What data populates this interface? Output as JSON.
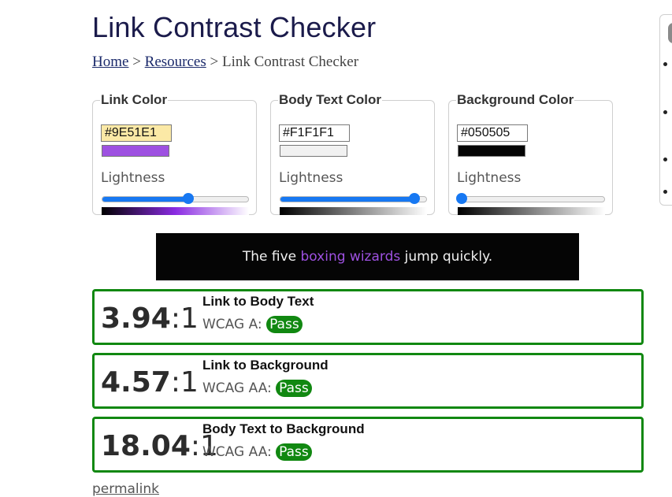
{
  "page": {
    "title": "Link Contrast Checker",
    "breadcrumb": {
      "home": "Home",
      "sep1": ">",
      "resources": "Resources",
      "sep2": ">",
      "current": "Link Contrast Checker"
    }
  },
  "pickers": [
    {
      "legend": "Link Color",
      "hex": "#9E51E1",
      "swatch": "#9e51e1",
      "lightness_label": "Lightness",
      "lightness": 0.59,
      "gradient_mid": "#8a2be2"
    },
    {
      "legend": "Body Text Color",
      "hex": "#F1F1F1",
      "swatch": "#f1f1f1",
      "lightness_label": "Lightness",
      "lightness": 0.92,
      "gradient_mid": "#808080"
    },
    {
      "legend": "Background Color",
      "hex": "#050505",
      "swatch": "#050505",
      "lightness_label": "Lightness",
      "lightness": 0.02,
      "gradient_mid": "#808080"
    }
  ],
  "preview": {
    "before": "The five ",
    "link": "boxing wizards",
    "after": " jump quickly."
  },
  "results": [
    {
      "ratio": "3.94",
      "suffix": ":1",
      "title": "Link to Body Text",
      "wcag": "WCAG A:",
      "status": "Pass"
    },
    {
      "ratio": "4.57",
      "suffix": ":1",
      "title": "Link to Background",
      "wcag": "WCAG AA:",
      "status": "Pass"
    },
    {
      "ratio": "18.04",
      "suffix": ":1",
      "title": "Body Text to Background",
      "wcag": "WCAG AA:",
      "status": "Pass"
    }
  ],
  "footer": {
    "permalink": "permalink"
  },
  "colors": {
    "pass": "#118811",
    "slider": "#1778f2",
    "title": "#1b1b4b"
  }
}
